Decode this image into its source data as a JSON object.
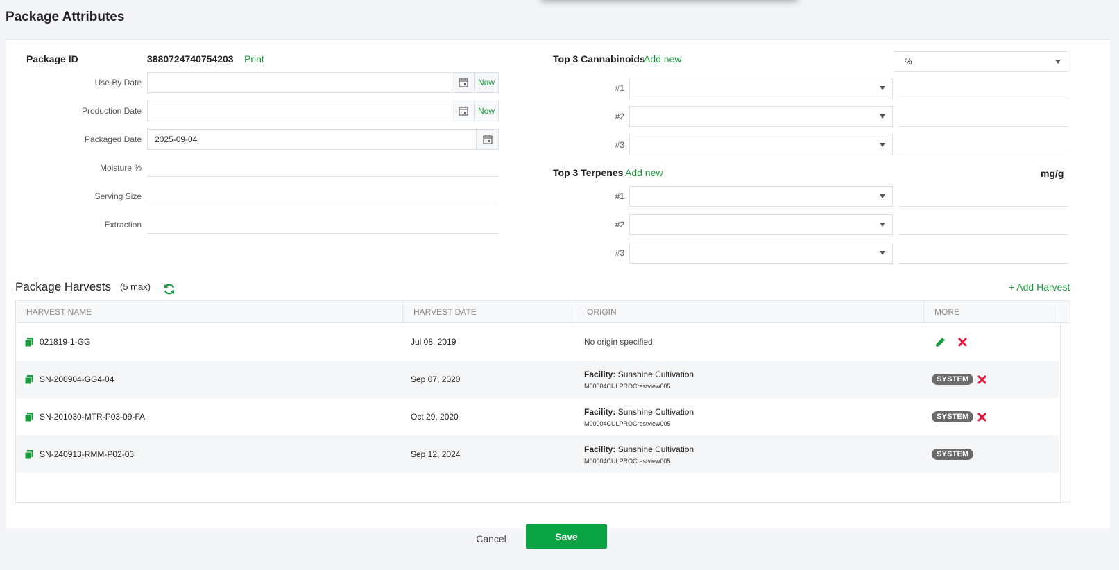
{
  "page": {
    "title": "Package Attributes"
  },
  "attributes": {
    "package_id_label": "Package ID",
    "package_id_value": "3880724740754203",
    "print_label": "Print",
    "use_by_label": "Use By Date",
    "use_by_value": "",
    "production_label": "Production Date",
    "production_value": "",
    "packaged_label": "Packaged Date",
    "packaged_value": "2025-09-04",
    "now_label": "Now",
    "moisture_label": "Moisture %",
    "serving_label": "Serving Size",
    "extraction_label": "Extraction"
  },
  "cannabinoids": {
    "label": "Top 3 Cannabinoids",
    "add_new": "Add new",
    "unit_select": "%",
    "rows": [
      "#1",
      "#2",
      "#3"
    ]
  },
  "terpenes": {
    "label": "Top 3 Terpenes",
    "add_new": "Add new",
    "unit": "mg/g",
    "rows": [
      "#1",
      "#2",
      "#3"
    ]
  },
  "harvests": {
    "title": "Package Harvests",
    "max_note": "(5 max)",
    "add_label": "+ Add Harvest",
    "columns": [
      "HARVEST NAME",
      "HARVEST DATE",
      "ORIGIN",
      "MORE"
    ],
    "rows": [
      {
        "name": "021819-1-GG",
        "date": "Jul 08, 2019",
        "origin_plain": "No origin specified",
        "origin_key": "",
        "origin_value": "",
        "origin_sub": "",
        "badge": ""
      },
      {
        "name": "SN-200904-GG4-04",
        "date": "Sep 07, 2020",
        "origin_plain": "",
        "origin_key": "Facility:",
        "origin_value": "Sunshine Cultivation",
        "origin_sub": "M00004CULPROCrestview005",
        "badge": "SYSTEM"
      },
      {
        "name": "SN-201030-MTR-P03-09-FA",
        "date": "Oct 29, 2020",
        "origin_plain": "",
        "origin_key": "Facility:",
        "origin_value": "Sunshine Cultivation",
        "origin_sub": "M00004CULPROCrestview005",
        "badge": "SYSTEM"
      },
      {
        "name": "SN-240913-RMM-P02-03",
        "date": "Sep 12, 2024",
        "origin_plain": "",
        "origin_key": "Facility:",
        "origin_value": "Sunshine Cultivation",
        "origin_sub": "M00004CULPROCrestview005",
        "badge": "SYSTEM"
      }
    ]
  },
  "footer": {
    "cancel": "Cancel",
    "save": "Save"
  },
  "colors": {
    "accent": "#0aa444",
    "link": "#1a9c3e",
    "delete": "#e3173e",
    "badge": "#6b6b6b"
  }
}
